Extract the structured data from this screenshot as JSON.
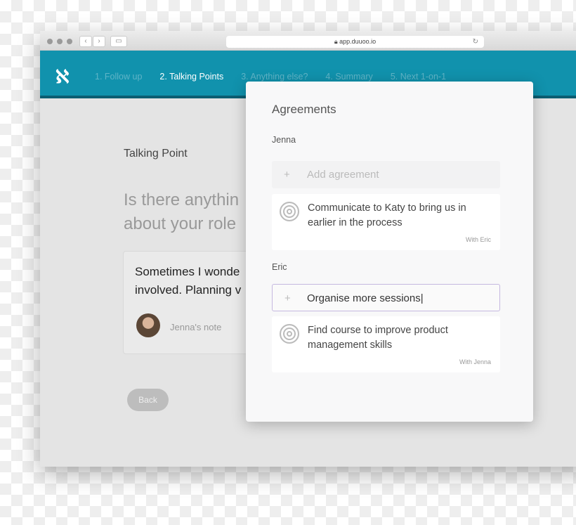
{
  "browser": {
    "url": "app.duuoo.io"
  },
  "nav": {
    "steps": [
      "1. Follow up",
      "2. Talking Points",
      "3. Anything else?",
      "4. Summary",
      "5. Next 1-on-1"
    ],
    "active_index": 1
  },
  "main": {
    "label": "Talking Point",
    "question_lines": [
      "Is there anythin",
      "about your role"
    ],
    "note_lines": [
      "Sometimes I wonde",
      "involved. Planning v"
    ],
    "note_author": "Jenna's note",
    "back_label": "Back"
  },
  "modal": {
    "title": "Agreements",
    "sections": [
      {
        "person": "Jenna",
        "input_placeholder": "Add agreement",
        "input_value": "",
        "items": [
          {
            "text": "Communicate to Katy to bring us in earlier in the process",
            "with": "With Eric"
          }
        ]
      },
      {
        "person": "Eric",
        "input_placeholder": "Add agreement",
        "input_value": "Organise more sessions",
        "items": [
          {
            "text": "Find course to improve product management skills",
            "with": "With Jenna"
          }
        ]
      }
    ]
  },
  "colors": {
    "header": "#1192ad",
    "focus_border": "#c5b8e0"
  }
}
